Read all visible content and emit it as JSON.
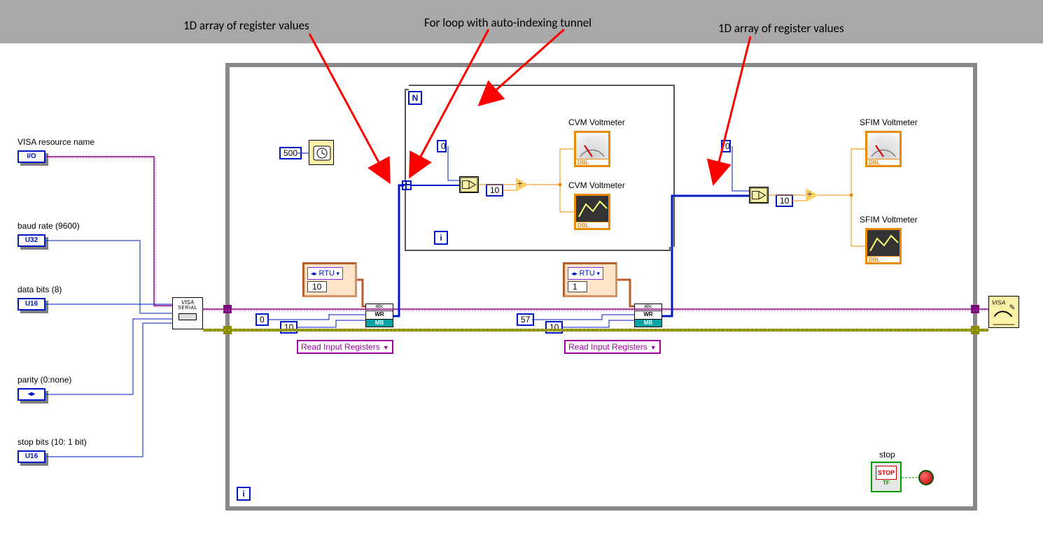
{
  "annotations": {
    "arr1": "1D array of register values",
    "forloop": "For loop with auto-indexing tunnel",
    "arr2": "1D array of register values"
  },
  "controls": {
    "visa": {
      "label": "VISA resource name",
      "type": "I/O"
    },
    "baud": {
      "label": "baud rate (9600)",
      "type": "U32"
    },
    "databits": {
      "label": "data bits (8)",
      "type": "U16"
    },
    "parity": {
      "label": "parity (0:none)",
      "type": "◂▸"
    },
    "stopbits": {
      "label": "stop bits (10: 1 bit)",
      "type": "U16"
    }
  },
  "constants": {
    "wait_ms": "500",
    "addr1_start": "0",
    "addr1_count": "10",
    "addr2_start": "57",
    "addr2_count": "10",
    "idx0a": "0",
    "div10a": "10",
    "idx0b": "0",
    "div10b": "10"
  },
  "clusters": {
    "mb1": {
      "mode": "RTU",
      "slave": "10"
    },
    "mb2": {
      "mode": "RTU",
      "slave": "1"
    }
  },
  "mb_function": "Read Input Registers",
  "indicators": {
    "cvm_gauge": "CVM Voltmeter",
    "cvm_chart": "CVM Voltmeter",
    "sfim_gauge": "SFIM Voltmeter",
    "sfim_chart": "SFIM Voltmeter"
  },
  "stop": {
    "label": "stop",
    "button": "STOP",
    "tf": "TF"
  },
  "visa_serial": {
    "l1": "VISA",
    "l2": "SERIAL"
  },
  "dbl": "DBL",
  "mb_wr": "WR",
  "mb_mb": "MB",
  "mb_abc": "abc"
}
